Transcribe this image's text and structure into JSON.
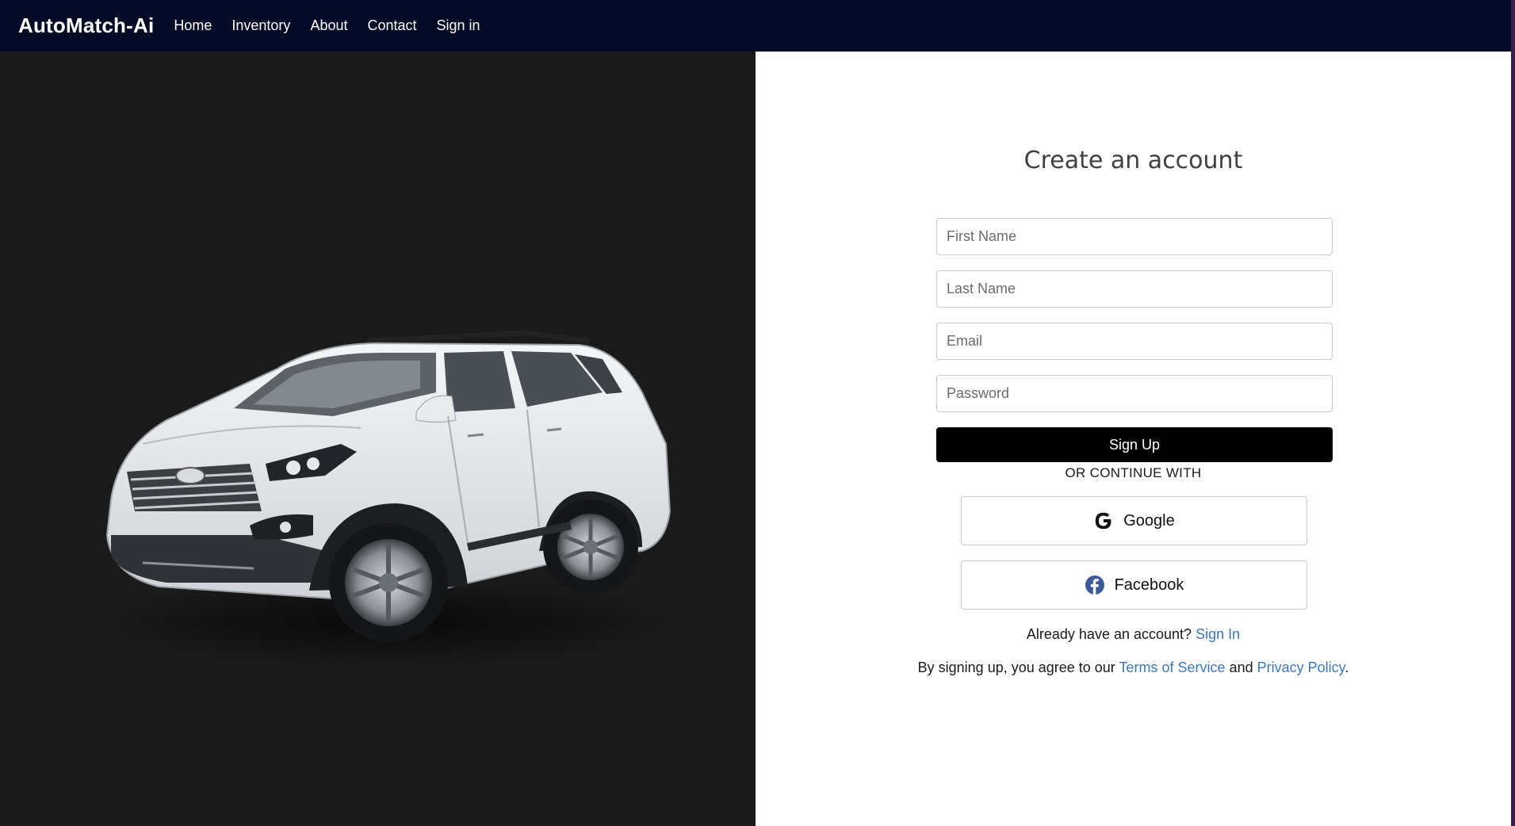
{
  "nav": {
    "brand": "AutoMatch-Ai",
    "links": [
      "Home",
      "Inventory",
      "About",
      "Contact",
      "Sign in"
    ]
  },
  "form": {
    "title": "Create an account",
    "first_name_placeholder": "First Name",
    "last_name_placeholder": "Last Name",
    "email_placeholder": "Email",
    "password_placeholder": "Password",
    "signup_label": "Sign Up",
    "or_text": "OR CONTINUE WITH",
    "google_label": "Google",
    "facebook_label": "Facebook",
    "have_account_text": "Already have an account?",
    "sign_in_link": "Sign In",
    "agree_prefix": "By signing up, you agree to our",
    "terms_link": "Terms of Service",
    "and_text": "and",
    "privacy_link": "Privacy Policy",
    "period": "."
  },
  "colors": {
    "navbar": "#030a26",
    "left_panel": "#1a1a1a",
    "primary_button": "#000000",
    "link": "#3a78c3",
    "facebook": "#3b5998"
  },
  "icons": {
    "google": "google-icon",
    "facebook": "facebook-icon"
  }
}
